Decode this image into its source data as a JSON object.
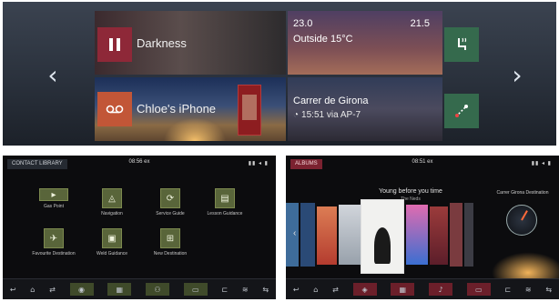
{
  "top": {
    "arrows": {
      "left": "‹",
      "right": "›"
    },
    "media": {
      "title": "Darkness",
      "icon": "pause-icon"
    },
    "weather": {
      "temp_left": "23.0",
      "temp_right": "21.5",
      "outside": "Outside 15°C",
      "icon": "seat-heat-icon"
    },
    "phone": {
      "title": "Chloe's iPhone",
      "icon": "voicemail-icon"
    },
    "navigation": {
      "street": "Carrer de Girona",
      "eta": "15:51 via AP-7",
      "icon": "route-icon"
    }
  },
  "home_screen": {
    "chip": "CONTACT LIBRARY",
    "clock": "08:56 ex",
    "status_icons": "▮▮ ◂ ▮",
    "apps": [
      {
        "label": "Gas Point",
        "icon": "gas-icon"
      },
      {
        "label": "Navigation",
        "icon": "navigation-icon"
      },
      {
        "label": "Service Guide",
        "icon": "service-icon"
      },
      {
        "label": "Lesson Guidance",
        "icon": "lesson-icon"
      },
      {
        "label": "Favourite Destination",
        "icon": "favourite-icon"
      },
      {
        "label": "Weld Guidance",
        "icon": "weld-icon"
      },
      {
        "label": "New Destination",
        "icon": "new-destination-icon"
      }
    ],
    "dock": [
      "↩",
      "⌂",
      "⇄",
      "◉",
      "▦",
      "⚇",
      "▭",
      "⊏",
      "≋",
      "⇆"
    ]
  },
  "media_screen": {
    "chip": "ALBUMS",
    "clock": "08:51 ex",
    "status_icons": "▮▮ ◂ ▮",
    "track_title": "Young before you time",
    "track_sub": "The Neds",
    "prev": "‹",
    "map_label": "Carrer Girona Destination",
    "dock": [
      "↩",
      "⌂",
      "⇄",
      "◈",
      "▦",
      "♪",
      "▭",
      "⊏",
      "≋",
      "⇆"
    ]
  }
}
